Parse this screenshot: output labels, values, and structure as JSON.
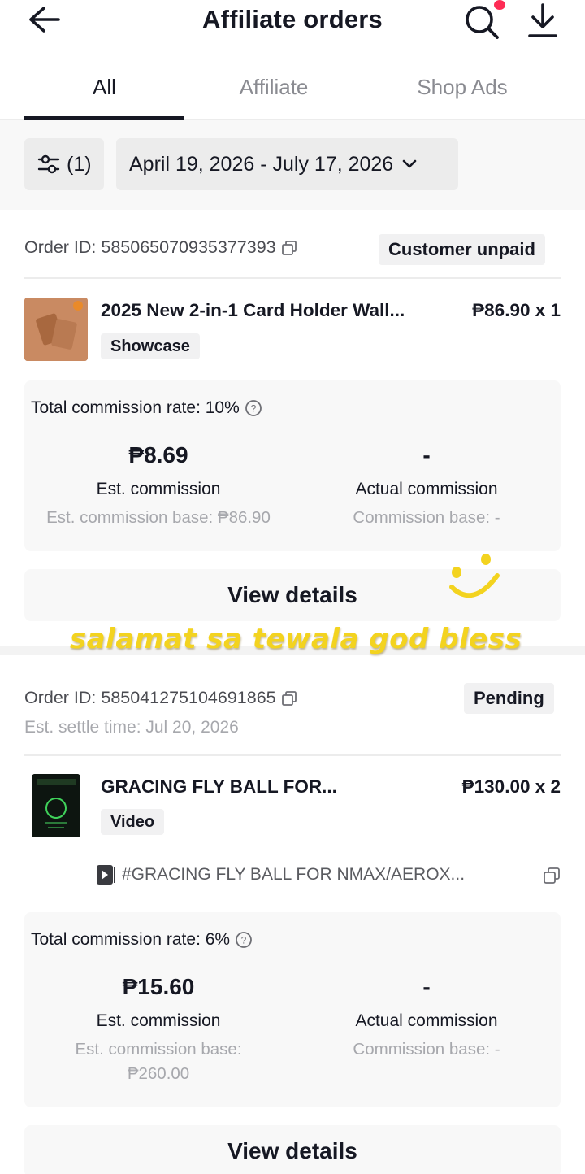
{
  "header": {
    "title": "Affiliate orders",
    "back_icon": "arrow-left-icon",
    "search_icon": "search-icon",
    "download_icon": "download-icon",
    "notification_dot_color": "#fe2c55"
  },
  "tabs": [
    {
      "label": "All",
      "active": true
    },
    {
      "label": "Affiliate",
      "active": false
    },
    {
      "label": "Shop Ads",
      "active": false
    }
  ],
  "filters": {
    "filter_count": "(1)",
    "date_range": "April 19, 2026 - July 17, 2026"
  },
  "orders": [
    {
      "order_id": "Order ID: 585065070935377393",
      "status": "Customer unpaid",
      "product_name": "2025 New 2-in-1 Card Holder Wall...",
      "price_qty": "₱86.90 x 1",
      "tag": "Showcase",
      "commission_rate": "Total commission rate: 10%",
      "est_commission": "₱8.69",
      "est_commission_label": "Est. commission",
      "est_commission_base": "Est. commission base: ₱86.90",
      "actual_commission": "-",
      "actual_commission_label": "Actual commission",
      "commission_base": "Commission base: -",
      "view_details": "View details"
    },
    {
      "order_id": "Order ID: 585041275104691865",
      "status": "Pending",
      "settle_time": "Est. settle time: Jul 20, 2026",
      "product_name": "GRACING FLY BALL FOR...",
      "price_qty": "₱130.00 x 2",
      "tag": "Video",
      "video_title": "#GRACING FLY BALL FOR NMAX/AEROX...",
      "commission_rate": "Total commission rate: 6%",
      "est_commission": "₱15.60",
      "est_commission_label": "Est. commission",
      "est_commission_base_line1": "Est. commission base:",
      "est_commission_base_line2": "₱260.00",
      "actual_commission": "-",
      "actual_commission_label": "Actual commission",
      "commission_base": "Commission base: -",
      "view_details": "View details"
    }
  ],
  "overlay": {
    "caption": "salamat sa tewala god bless",
    "caption_color": "#f3d31f",
    "sticker": "smiley-icon"
  }
}
